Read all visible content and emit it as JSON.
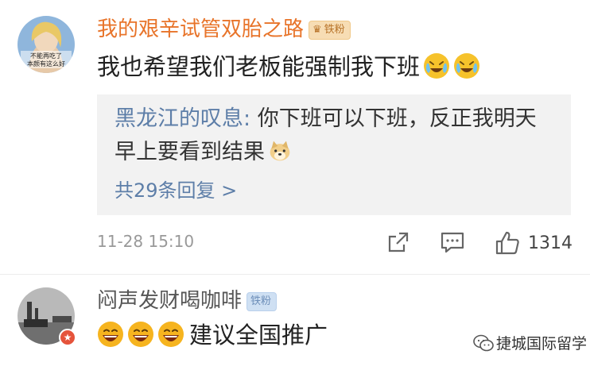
{
  "comments": [
    {
      "username": "我的艰辛试管双胎之路",
      "badge": "铁粉",
      "text": "我也希望我们老板能强制我下班",
      "avatar_caption_1": "不能再吃了",
      "avatar_caption_2": "本颜有这么好",
      "reply": {
        "author": "黑龙江的叹息:",
        "text_line1": " 你下班可以下班，反正我明天",
        "text_line2": "早上要看到结果",
        "more": "共29条回复 >"
      },
      "time": "11-28 15:10",
      "likes": "1314"
    },
    {
      "username": "闷声发财喝咖啡",
      "badge": "铁粉",
      "text": "建议全国推广"
    }
  ],
  "watermark": "捷城国际留学",
  "colors": {
    "username_accent": "#e8742a",
    "reply_author": "#5d7ea8",
    "reply_background": "#f2f2f2"
  }
}
